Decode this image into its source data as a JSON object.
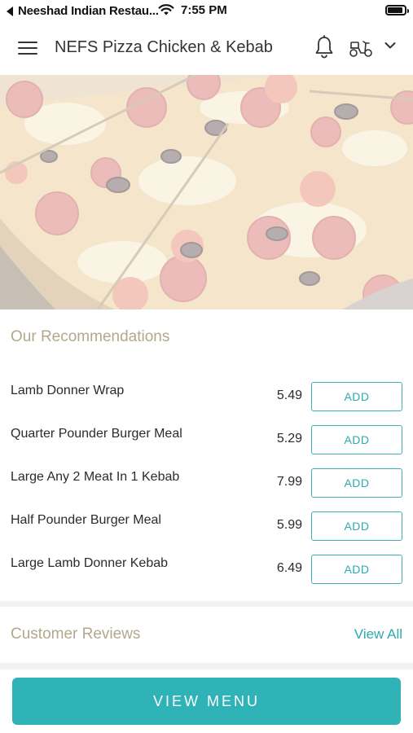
{
  "status_bar": {
    "carrier": "Neeshad Indian Restau...",
    "time": "7:55 PM",
    "battery_level": 0.9
  },
  "header": {
    "title": "NEFS Pizza Chicken & Kebab",
    "icons": [
      "menu-icon",
      "bell-icon",
      "scooter-icon",
      "chevron-down-icon"
    ]
  },
  "recommendations": {
    "title": "Our Recommendations",
    "add_label": "ADD",
    "items": [
      {
        "name": "Lamb Donner Wrap",
        "price": "5.49",
        "add": "ADD"
      },
      {
        "name": "Quarter Pounder Burger Meal",
        "price": "5.29",
        "add": "ADD"
      },
      {
        "name": "Large Any 2 Meat In 1 Kebab",
        "price": "7.99",
        "add": "ADD"
      },
      {
        "name": "Half Pounder Burger Meal",
        "price": "5.99",
        "add": "ADD"
      },
      {
        "name": "Large Lamb Donner Kebab",
        "price": "6.49",
        "add": "ADD"
      }
    ]
  },
  "reviews": {
    "title": "Customer Reviews",
    "view_all": "View All"
  },
  "footer": {
    "view_menu": "VIEW MENU"
  },
  "colors": {
    "accent": "#2fb3b7",
    "section_title": "#b3a88c"
  }
}
